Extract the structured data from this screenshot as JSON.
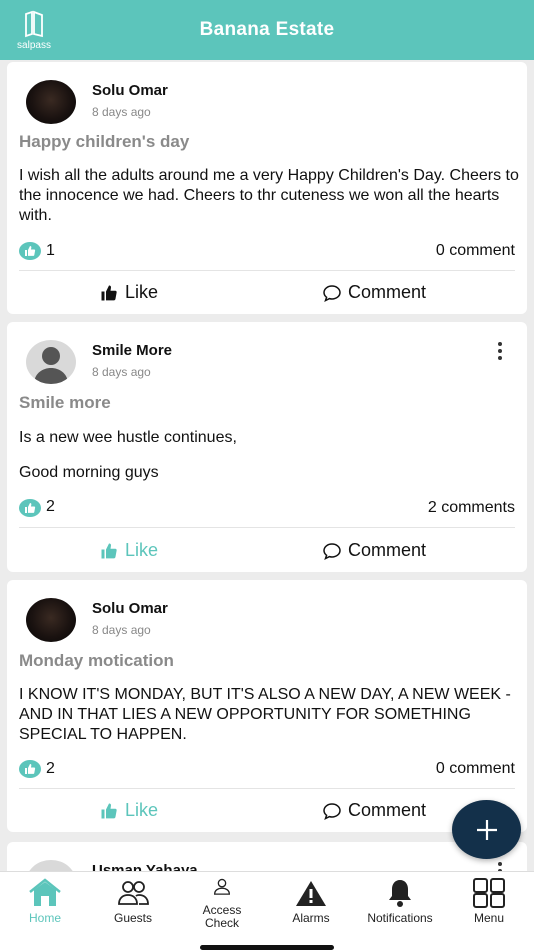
{
  "header": {
    "logo_text": "salpass",
    "title": "Banana Estate"
  },
  "posts": [
    {
      "author": "Solu Omar",
      "time": "8 days ago",
      "title": "Happy children's day",
      "body": [
        "I wish all the adults around me a very Happy Children's Day. Cheers to the innocence we had. Cheers to thr cuteness we won all the hearts with."
      ],
      "likes": "1",
      "comments": "0 comment",
      "like_label": "Like",
      "comment_label": "Comment"
    },
    {
      "author": "Smile More",
      "time": "8 days ago",
      "title": "Smile more",
      "body": [
        "Is a new wee hustle continues,",
        "Good morning guys"
      ],
      "likes": "2",
      "comments": "2 comments",
      "like_label": "Like",
      "comment_label": "Comment"
    },
    {
      "author": "Solu Omar",
      "time": "8 days ago",
      "title": "Monday motication",
      "body": [
        "I KNOW IT'S MONDAY, BUT IT'S ALSO A NEW DAY, A NEW WEEK - AND IN THAT LIES A NEW OPPORTUNITY FOR SOMETHING SPECIAL TO HAPPEN."
      ],
      "likes": "2",
      "comments": "0 comment",
      "like_label": "Like",
      "comment_label": "Comment"
    },
    {
      "author": "Usman Yahaya"
    }
  ],
  "tabs": [
    {
      "label": "Home",
      "icon": "home-icon",
      "active": true
    },
    {
      "label": "Guests",
      "icon": "guests-icon"
    },
    {
      "label": "Access Check",
      "icon": "access-check-icon"
    },
    {
      "label": "Alarms",
      "icon": "alarm-icon"
    },
    {
      "label": "Notifications",
      "icon": "bell-icon"
    },
    {
      "label": "Menu",
      "icon": "menu-grid-icon"
    }
  ],
  "colors": {
    "accent": "#5cc5bb",
    "fab": "#13304a"
  }
}
